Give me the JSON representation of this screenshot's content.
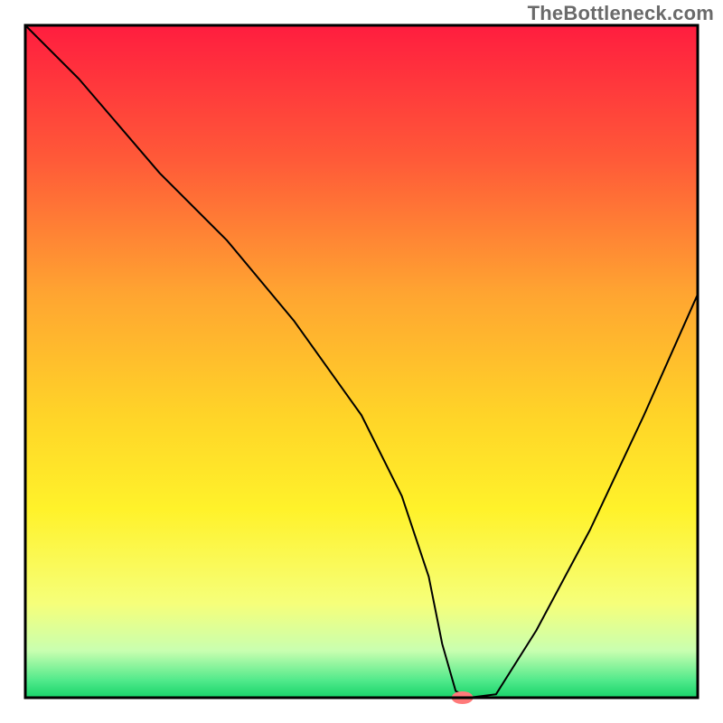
{
  "watermark": {
    "text": "TheBottleneck.com"
  },
  "chart_data": {
    "type": "line",
    "title": "",
    "xlabel": "",
    "ylabel": "",
    "xlim": [
      0,
      100
    ],
    "ylim": [
      0,
      100
    ],
    "grid": false,
    "legend": false,
    "background_gradient": {
      "stops": [
        {
          "offset": 0.0,
          "color": "#ff1d3f"
        },
        {
          "offset": 0.2,
          "color": "#ff5a38"
        },
        {
          "offset": 0.4,
          "color": "#ffa531"
        },
        {
          "offset": 0.58,
          "color": "#ffd428"
        },
        {
          "offset": 0.72,
          "color": "#fff22a"
        },
        {
          "offset": 0.86,
          "color": "#f6ff7a"
        },
        {
          "offset": 0.93,
          "color": "#c9ffb0"
        },
        {
          "offset": 0.975,
          "color": "#4fe98a"
        },
        {
          "offset": 1.0,
          "color": "#18d36a"
        }
      ]
    },
    "series": [
      {
        "name": "bottleneck-curve",
        "stroke": "#000000",
        "stroke_width": 2,
        "x": [
          0,
          8,
          20,
          30,
          40,
          50,
          56,
          60,
          62,
          64,
          66,
          70,
          76,
          84,
          92,
          100
        ],
        "y": [
          100,
          92,
          78,
          68,
          56,
          42,
          30,
          18,
          8,
          1,
          0,
          0.5,
          10,
          25,
          42,
          60
        ]
      }
    ],
    "marker": {
      "name": "optimal-point",
      "x": 65,
      "y": 0,
      "color": "#ff7a7a",
      "rx": 12,
      "ry": 7
    },
    "frame": {
      "stroke": "#000000",
      "stroke_width": 3
    }
  }
}
